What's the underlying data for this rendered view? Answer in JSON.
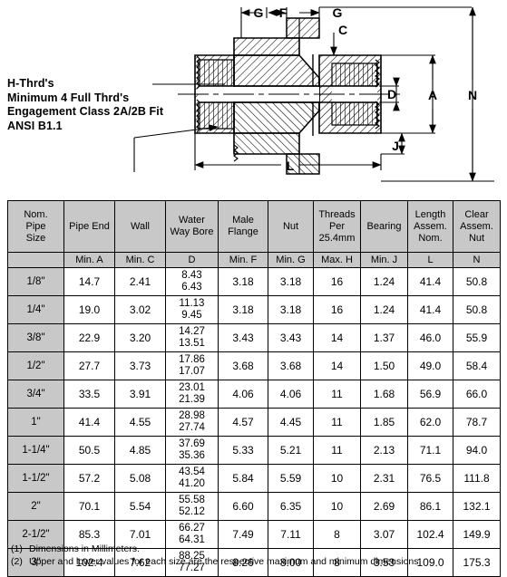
{
  "drawing": {
    "title": "pipe-union-cross-section",
    "dimension_labels": [
      "G",
      "F",
      "G",
      "C",
      "D",
      "A",
      "N",
      "J",
      "L"
    ],
    "note_lines": [
      "H-Thrd's",
      "Minimum 4  Full  Thrd's",
      "Engagement  Class   2A/2B  Fit",
      "ANSI B1.1"
    ]
  },
  "table": {
    "group_headers": [
      "Nom.\nPipe\nSize",
      "Pipe End",
      "Wall",
      "Water\nWay Bore",
      "Male\nFlange",
      "Nut",
      "Threads\nPer\n25.4mm",
      "Bearing",
      "Length\nAssem.\nNom.",
      "Clear\nAssem.\nNut"
    ],
    "group_headers_lines": [
      [
        "Nom.",
        "Pipe",
        "Size"
      ],
      [
        "Pipe End"
      ],
      [
        "Wall"
      ],
      [
        "Water",
        "Way Bore"
      ],
      [
        "Male",
        "Flange"
      ],
      [
        "Nut"
      ],
      [
        "Threads",
        "Per",
        "25.4mm"
      ],
      [
        "Bearing"
      ],
      [
        "Length",
        "Assem.",
        "Nom."
      ],
      [
        "Clear",
        "Assem.",
        "Nut"
      ]
    ],
    "symbol_headers": [
      "",
      "Min. A",
      "Min. C",
      "D",
      "Min. F",
      "Min. G",
      "Max. H",
      "Min. J",
      "L",
      "N"
    ],
    "rows": [
      {
        "size": "1/8\"",
        "a": "14.7",
        "c": "2.41",
        "d_max": "8.43",
        "d_min": "6.43",
        "f": "3.18",
        "g": "3.18",
        "h": "16",
        "j": "1.24",
        "l": "41.4",
        "n": "50.8"
      },
      {
        "size": "1/4\"",
        "a": "19.0",
        "c": "3.02",
        "d_max": "11.13",
        "d_min": "9.45",
        "f": "3.18",
        "g": "3.18",
        "h": "16",
        "j": "1.24",
        "l": "41.4",
        "n": "50.8"
      },
      {
        "size": "3/8\"",
        "a": "22.9",
        "c": "3.20",
        "d_max": "14.27",
        "d_min": "13.51",
        "f": "3.43",
        "g": "3.43",
        "h": "14",
        "j": "1.37",
        "l": "46.0",
        "n": "55.9"
      },
      {
        "size": "1/2\"",
        "a": "27.7",
        "c": "3.73",
        "d_max": "17.86",
        "d_min": "17.07",
        "f": "3.68",
        "g": "3.68",
        "h": "14",
        "j": "1.50",
        "l": "49.0",
        "n": "58.4"
      },
      {
        "size": "3/4\"",
        "a": "33.5",
        "c": "3.91",
        "d_max": "23.01",
        "d_min": "21.39",
        "f": "4.06",
        "g": "4.06",
        "h": "11",
        "j": "1.68",
        "l": "56.9",
        "n": "66.0"
      },
      {
        "size": "1\"",
        "a": "41.4",
        "c": "4.55",
        "d_max": "28.98",
        "d_min": "27.74",
        "f": "4.57",
        "g": "4.45",
        "h": "11",
        "j": "1.85",
        "l": "62.0",
        "n": "78.7"
      },
      {
        "size": "1-1/4\"",
        "a": "50.5",
        "c": "4.85",
        "d_max": "37.69",
        "d_min": "35.36",
        "f": "5.33",
        "g": "5.21",
        "h": "11",
        "j": "2.13",
        "l": "71.1",
        "n": "94.0"
      },
      {
        "size": "1-1/2\"",
        "a": "57.2",
        "c": "5.08",
        "d_max": "43.54",
        "d_min": "41.20",
        "f": "5.84",
        "g": "5.59",
        "h": "10",
        "j": "2.31",
        "l": "76.5",
        "n": "111.8"
      },
      {
        "size": "2\"",
        "a": "70.1",
        "c": "5.54",
        "d_max": "55.58",
        "d_min": "52.12",
        "f": "6.60",
        "g": "6.35",
        "h": "10",
        "j": "2.69",
        "l": "86.1",
        "n": "132.1"
      },
      {
        "size": "2-1/2\"",
        "a": "85.3",
        "c": "7.01",
        "d_max": "66.27",
        "d_min": "64.31",
        "f": "7.49",
        "g": "7.11",
        "h": "8",
        "j": "3.07",
        "l": "102.4",
        "n": "149.9"
      },
      {
        "size": "3\"",
        "a": "102.4",
        "c": "7.62",
        "d_max": "88.25",
        "d_min": "77.27",
        "f": "8.26",
        "g": "8.00",
        "h": "8",
        "j": "3.53",
        "l": "109.0",
        "n": "175.3"
      }
    ]
  },
  "footnotes": [
    {
      "num": "(1)",
      "text": "Dimensions in Millimeters."
    },
    {
      "num": "(2)",
      "text": "Upper and lower values for each size are the respective maximum and minimum dimensions."
    }
  ],
  "colors": {
    "header_bg": "#c8c8c8",
    "line": "#000000",
    "cell_bg": "#ffffff"
  }
}
